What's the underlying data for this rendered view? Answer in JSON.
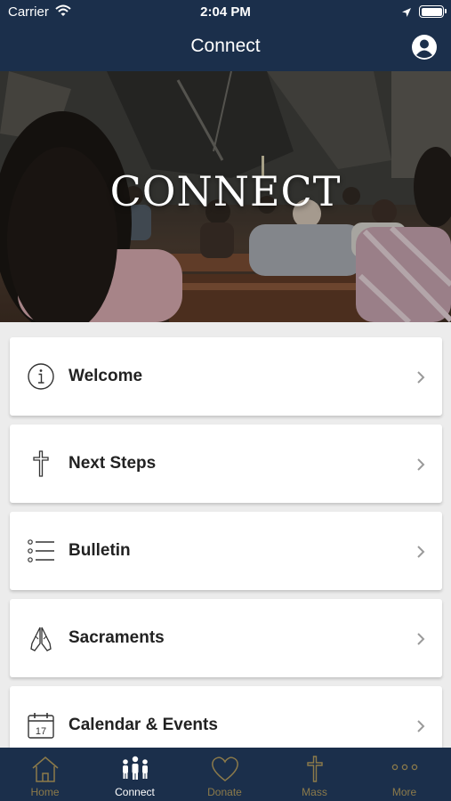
{
  "status_bar": {
    "carrier": "Carrier",
    "time": "2:04 PM"
  },
  "nav": {
    "title": "Connect"
  },
  "hero": {
    "title": "CONNECT"
  },
  "menu": [
    {
      "label": "Welcome",
      "icon": "info-icon"
    },
    {
      "label": "Next Steps",
      "icon": "cross-icon"
    },
    {
      "label": "Bulletin",
      "icon": "list-icon"
    },
    {
      "label": "Sacraments",
      "icon": "praying-hands-icon"
    },
    {
      "label": "Calendar & Events",
      "icon": "calendar-icon",
      "calendar_day": "17"
    }
  ],
  "tabs": [
    {
      "label": "Home",
      "icon": "home-icon",
      "active": false
    },
    {
      "label": "Connect",
      "icon": "people-icon",
      "active": true
    },
    {
      "label": "Donate",
      "icon": "heart-icon",
      "active": false
    },
    {
      "label": "Mass",
      "icon": "cross-icon",
      "active": false
    },
    {
      "label": "More",
      "icon": "more-icon",
      "active": false
    }
  ],
  "colors": {
    "bar": "#1b2f4b",
    "tab_active": "#ffffff",
    "tab_inactive": "#8c7a4a",
    "background": "#ececec"
  }
}
